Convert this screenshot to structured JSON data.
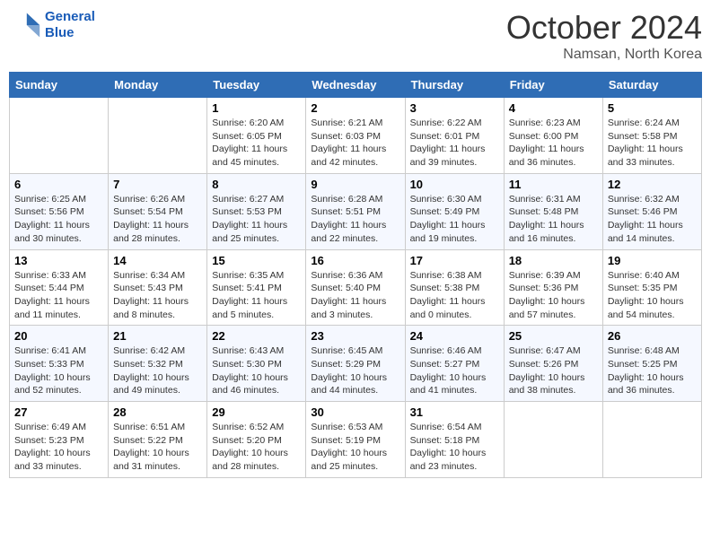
{
  "header": {
    "logo_line1": "General",
    "logo_line2": "Blue",
    "month": "October 2024",
    "location": "Namsan, North Korea"
  },
  "days_of_week": [
    "Sunday",
    "Monday",
    "Tuesday",
    "Wednesday",
    "Thursday",
    "Friday",
    "Saturday"
  ],
  "weeks": [
    [
      {
        "day": "",
        "info": ""
      },
      {
        "day": "",
        "info": ""
      },
      {
        "day": "1",
        "info": "Sunrise: 6:20 AM\nSunset: 6:05 PM\nDaylight: 11 hours and 45 minutes."
      },
      {
        "day": "2",
        "info": "Sunrise: 6:21 AM\nSunset: 6:03 PM\nDaylight: 11 hours and 42 minutes."
      },
      {
        "day": "3",
        "info": "Sunrise: 6:22 AM\nSunset: 6:01 PM\nDaylight: 11 hours and 39 minutes."
      },
      {
        "day": "4",
        "info": "Sunrise: 6:23 AM\nSunset: 6:00 PM\nDaylight: 11 hours and 36 minutes."
      },
      {
        "day": "5",
        "info": "Sunrise: 6:24 AM\nSunset: 5:58 PM\nDaylight: 11 hours and 33 minutes."
      }
    ],
    [
      {
        "day": "6",
        "info": "Sunrise: 6:25 AM\nSunset: 5:56 PM\nDaylight: 11 hours and 30 minutes."
      },
      {
        "day": "7",
        "info": "Sunrise: 6:26 AM\nSunset: 5:54 PM\nDaylight: 11 hours and 28 minutes."
      },
      {
        "day": "8",
        "info": "Sunrise: 6:27 AM\nSunset: 5:53 PM\nDaylight: 11 hours and 25 minutes."
      },
      {
        "day": "9",
        "info": "Sunrise: 6:28 AM\nSunset: 5:51 PM\nDaylight: 11 hours and 22 minutes."
      },
      {
        "day": "10",
        "info": "Sunrise: 6:30 AM\nSunset: 5:49 PM\nDaylight: 11 hours and 19 minutes."
      },
      {
        "day": "11",
        "info": "Sunrise: 6:31 AM\nSunset: 5:48 PM\nDaylight: 11 hours and 16 minutes."
      },
      {
        "day": "12",
        "info": "Sunrise: 6:32 AM\nSunset: 5:46 PM\nDaylight: 11 hours and 14 minutes."
      }
    ],
    [
      {
        "day": "13",
        "info": "Sunrise: 6:33 AM\nSunset: 5:44 PM\nDaylight: 11 hours and 11 minutes."
      },
      {
        "day": "14",
        "info": "Sunrise: 6:34 AM\nSunset: 5:43 PM\nDaylight: 11 hours and 8 minutes."
      },
      {
        "day": "15",
        "info": "Sunrise: 6:35 AM\nSunset: 5:41 PM\nDaylight: 11 hours and 5 minutes."
      },
      {
        "day": "16",
        "info": "Sunrise: 6:36 AM\nSunset: 5:40 PM\nDaylight: 11 hours and 3 minutes."
      },
      {
        "day": "17",
        "info": "Sunrise: 6:38 AM\nSunset: 5:38 PM\nDaylight: 11 hours and 0 minutes."
      },
      {
        "day": "18",
        "info": "Sunrise: 6:39 AM\nSunset: 5:36 PM\nDaylight: 10 hours and 57 minutes."
      },
      {
        "day": "19",
        "info": "Sunrise: 6:40 AM\nSunset: 5:35 PM\nDaylight: 10 hours and 54 minutes."
      }
    ],
    [
      {
        "day": "20",
        "info": "Sunrise: 6:41 AM\nSunset: 5:33 PM\nDaylight: 10 hours and 52 minutes."
      },
      {
        "day": "21",
        "info": "Sunrise: 6:42 AM\nSunset: 5:32 PM\nDaylight: 10 hours and 49 minutes."
      },
      {
        "day": "22",
        "info": "Sunrise: 6:43 AM\nSunset: 5:30 PM\nDaylight: 10 hours and 46 minutes."
      },
      {
        "day": "23",
        "info": "Sunrise: 6:45 AM\nSunset: 5:29 PM\nDaylight: 10 hours and 44 minutes."
      },
      {
        "day": "24",
        "info": "Sunrise: 6:46 AM\nSunset: 5:27 PM\nDaylight: 10 hours and 41 minutes."
      },
      {
        "day": "25",
        "info": "Sunrise: 6:47 AM\nSunset: 5:26 PM\nDaylight: 10 hours and 38 minutes."
      },
      {
        "day": "26",
        "info": "Sunrise: 6:48 AM\nSunset: 5:25 PM\nDaylight: 10 hours and 36 minutes."
      }
    ],
    [
      {
        "day": "27",
        "info": "Sunrise: 6:49 AM\nSunset: 5:23 PM\nDaylight: 10 hours and 33 minutes."
      },
      {
        "day": "28",
        "info": "Sunrise: 6:51 AM\nSunset: 5:22 PM\nDaylight: 10 hours and 31 minutes."
      },
      {
        "day": "29",
        "info": "Sunrise: 6:52 AM\nSunset: 5:20 PM\nDaylight: 10 hours and 28 minutes."
      },
      {
        "day": "30",
        "info": "Sunrise: 6:53 AM\nSunset: 5:19 PM\nDaylight: 10 hours and 25 minutes."
      },
      {
        "day": "31",
        "info": "Sunrise: 6:54 AM\nSunset: 5:18 PM\nDaylight: 10 hours and 23 minutes."
      },
      {
        "day": "",
        "info": ""
      },
      {
        "day": "",
        "info": ""
      }
    ]
  ]
}
